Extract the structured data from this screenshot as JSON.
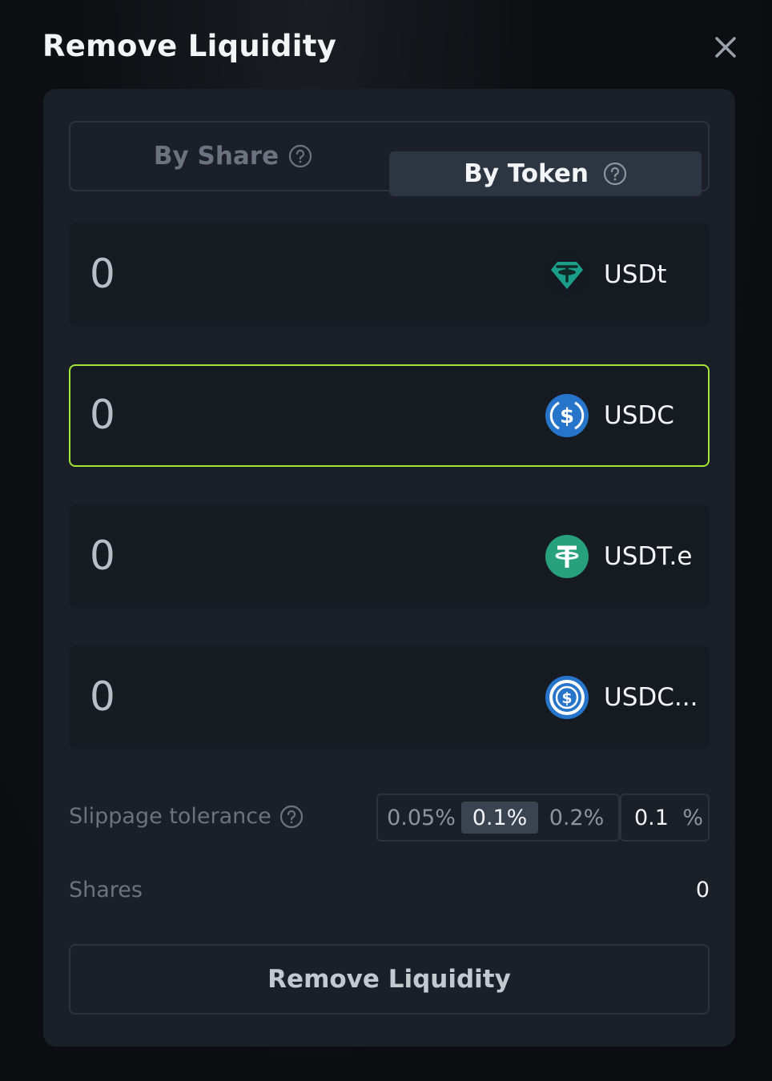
{
  "title": "Remove Liquidity",
  "tabs": [
    {
      "label": "By Share",
      "active": false
    },
    {
      "label": "By Token",
      "active": true
    }
  ],
  "tokens": [
    {
      "amount": "0",
      "symbol": "USDt",
      "icon": "tether-diamond-icon",
      "color": "#1a9e8a"
    },
    {
      "amount": "0",
      "symbol": "USDC",
      "icon": "usdc-icon",
      "color": "#2775ca",
      "focused": true
    },
    {
      "amount": "0",
      "symbol": "USDT.e",
      "icon": "tether-icon",
      "color": "#26a17b"
    },
    {
      "amount": "0",
      "symbol": "USDC...",
      "icon": "usdc-icon",
      "color": "#2775ca"
    }
  ],
  "slippage": {
    "label": "Slippage tolerance",
    "presets": [
      "0.05%",
      "0.1%",
      "0.2%"
    ],
    "selected": "0.1%",
    "input_value": "0.1",
    "unit": "%"
  },
  "shares": {
    "label": "Shares",
    "value": "0"
  },
  "submit_label": "Remove Liquidity",
  "colors": {
    "accent": "#a3e635",
    "card": "#1b2028",
    "row": "#161b21"
  }
}
